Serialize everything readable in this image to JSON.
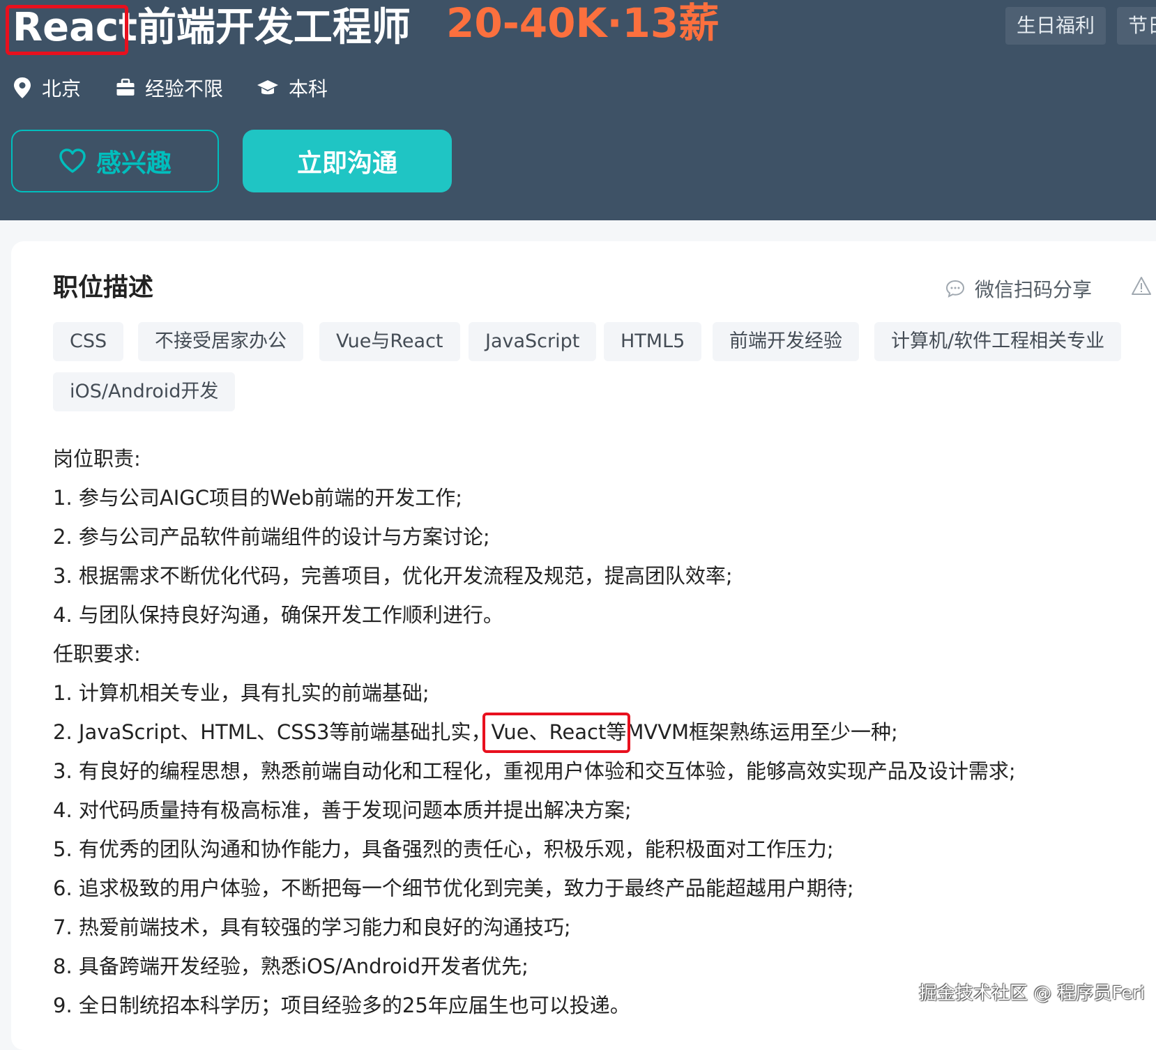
{
  "job": {
    "title": "React前端开发工程师",
    "salary": "20-40K·13薪",
    "benefits": [
      "生日福利",
      "节日"
    ],
    "meta": {
      "location": "北京",
      "experience": "经验不限",
      "education": "本科"
    },
    "actions": {
      "interest_label": "感兴趣",
      "chat_label": "立即沟通"
    }
  },
  "description": {
    "title": "职位描述",
    "share_label": "微信扫码分享",
    "tags": [
      "CSS",
      "不接受居家办公",
      "Vue与React",
      "JavaScript",
      "HTML5",
      "前端开发经验",
      "计算机/软件工程相关专业",
      "iOS/Android开发"
    ],
    "lines": [
      "岗位职责:",
      "1. 参与公司AIGC项目的Web前端的开发工作;",
      "2. 参与公司产品软件前端组件的设计与方案讨论;",
      "3. 根据需求不断优化代码，完善项目，优化开发流程及规范，提高团队效率;",
      "4. 与团队保持良好沟通，确保开发工作顺利进行。",
      "任职要求:",
      "1. 计算机相关专业，具有扎实的前端基础;",
      "2. JavaScript、HTML、CSS3等前端基础扎实，Vue、React等MVVM框架熟练运用至少一种;",
      "3. 有良好的编程思想，熟悉前端自动化和工程化，重视用户体验和交互体验，能够高效实现产品及设计需求;",
      "4. 对代码质量持有极高标准，善于发现问题本质并提出解决方案;",
      "5. 有优秀的团队沟通和协作能力，具备强烈的责任心，积极乐观，能积极面对工作压力;",
      "6. 追求极致的用户体验，不断把每一个细节优化到完美，致力于最终产品能超越用户期待;",
      "7. 热爱前端技术，具有较强的学习能力和良好的沟通技巧;",
      "8. 具备跨端开发经验，熟悉iOS/Android开发者优先;",
      "9. 全日制统招本科学历；项目经验多的25年应届生也可以投递。"
    ]
  },
  "watermark": "掘金技术社区 @ 程序员Feri",
  "colors": {
    "header_bg": "#3e5266",
    "salary": "#fc703e",
    "accent": "#00bebd",
    "chat_button": "#1fc5c4",
    "highlight_box": "#e8101e"
  },
  "icons": {
    "location": "map-pin-icon",
    "experience": "briefcase-icon",
    "education": "graduation-cap-icon",
    "interest": "heart-icon",
    "share": "chat-bubble-icon",
    "report": "warning-triangle-icon"
  }
}
